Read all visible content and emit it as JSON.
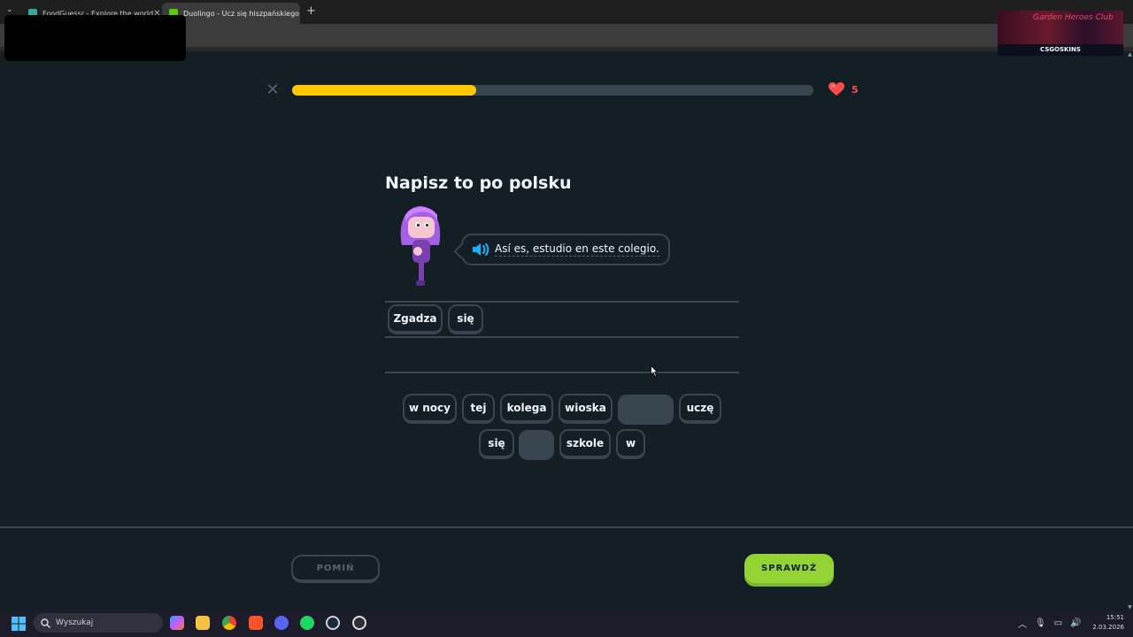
{
  "browser": {
    "tabs": [
      {
        "title": "FoodGuessr - Explore the world",
        "active": false
      },
      {
        "title": "Duolingo - Ucz się hiszpańskiego",
        "active": true
      }
    ],
    "new_tab_label": "+",
    "tab_close": "✕",
    "tab_list": "⌄"
  },
  "ad": {
    "script_text": "Garden Heroes Club",
    "brand": "CSG✪SKINS"
  },
  "lesson": {
    "progress_fraction": 0.353,
    "hearts": "5",
    "title": "Napisz to po polsku",
    "prompt": "Así es, estudio en este colegio.",
    "answer_chips": [
      "Zgadza",
      "się"
    ],
    "word_bank_row1": [
      "w nocy",
      "tej",
      "kolega",
      "wioska",
      "",
      "uczę"
    ],
    "word_bank_row2": [
      "się",
      "",
      "szkole",
      "w"
    ],
    "skip_label": "POMIŃ",
    "check_label": "SPRAWDŹ"
  },
  "colors": {
    "background": "#131f24",
    "progress": "#ffc800",
    "heart": "#ff4b4b",
    "check_button": "#93d333",
    "border": "#37464f"
  },
  "taskbar": {
    "search_placeholder": "Wyszukaj",
    "time": "15:51",
    "date": "2.03.2026",
    "icons": [
      "copilot-icon",
      "file-explorer-icon",
      "chrome-icon",
      "brave-icon",
      "discord-icon",
      "spotify-icon",
      "steam-icon",
      "obs-icon"
    ]
  }
}
